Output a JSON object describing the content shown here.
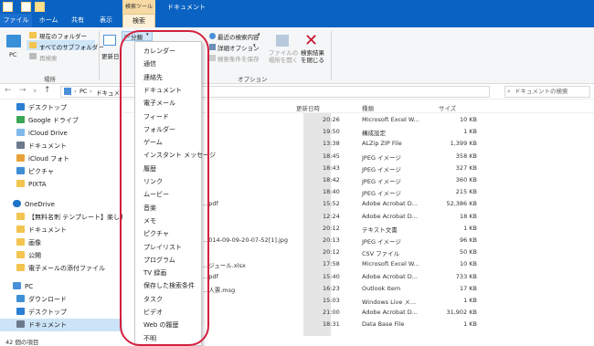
{
  "window": {
    "title": "ドキュメント",
    "context_header": "検索ツール"
  },
  "tabs": [
    "ファイル",
    "ホーム",
    "共有",
    "表示",
    "検索"
  ],
  "ribbon": {
    "pc_label": "PC",
    "current_folder": "現在のフォルダー",
    "all_subfolders": "すべてのサブフォルダー",
    "search_again": "再検索",
    "location_group": "場所",
    "updated_date": "更新日",
    "category_button": "分類",
    "recent_searches": "最近の検索内容",
    "advanced_options": "詳細オプション",
    "save_search": "検索条件を保存",
    "open_file_location": "ファイルの場所を開く",
    "close_search": "検索結果を閉じる",
    "options_group": "オプション"
  },
  "addressbar": {
    "path_root": "PC",
    "path_current": "ドキュメ",
    "search_placeholder": "ドキュメントの検索"
  },
  "dropdown_items": [
    "カレンダー",
    "通信",
    "連絡先",
    "ドキュメント",
    "電子メール",
    "フィード",
    "フォルダー",
    "ゲーム",
    "インスタント メッセージ",
    "履歴",
    "リンク",
    "ムービー",
    "音楽",
    "メモ",
    "ピクチャ",
    "プレイリスト",
    "プログラム",
    "TV 録画",
    "保存した検索条件",
    "タスク",
    "ビデオ",
    "Web の履歴",
    "不明"
  ],
  "nav": {
    "items": [
      {
        "label": "デスクトップ",
        "color": "#2a7fd4"
      },
      {
        "label": "Google ドライブ",
        "color": "#3aa757"
      },
      {
        "label": "iCloud Drive",
        "color": "#7fb8ea"
      },
      {
        "label": "ドキュメント",
        "color": "#6b7a8c"
      },
      {
        "label": "iCloud フォト",
        "color": "#e9a23b"
      },
      {
        "label": "ピクチャ",
        "color": "#3f8fd6"
      },
      {
        "label": "PIXTA",
        "color": "#f3c44f"
      },
      {
        "label": "OneDrive",
        "color": "#1e73c9"
      },
      {
        "label": "【無料名刺 テンプレート】楽しもう OF",
        "color": "#f3c44f"
      },
      {
        "label": "ドキュメント",
        "color": "#f3c44f"
      },
      {
        "label": "画像",
        "color": "#f3c44f"
      },
      {
        "label": "公開",
        "color": "#f3c44f"
      },
      {
        "label": "電子メールの添付ファイル",
        "color": "#f3c44f"
      },
      {
        "label": "PC",
        "color": "#4a90d9"
      },
      {
        "label": "ダウンロード",
        "color": "#3f8fd6"
      },
      {
        "label": "デスクトップ",
        "color": "#2a7fd4"
      },
      {
        "label": "ドキュメント",
        "color": "#6b7a8c"
      }
    ]
  },
  "columns": {
    "date": "更新日時",
    "type": "種類",
    "size": "サイズ"
  },
  "rows": [
    {
      "name": "",
      "time": "20:26",
      "type": "Microsoft Excel W...",
      "size": "10 KB"
    },
    {
      "name": "",
      "time": "19:50",
      "type": "構成設定",
      "size": "1 KB"
    },
    {
      "name": "",
      "time": "13:38",
      "type": "ALZip ZIP File",
      "size": "1,399 KB"
    },
    {
      "name": "",
      "time": "18:45",
      "type": "JPEG イメージ",
      "size": "358 KB"
    },
    {
      "name": "",
      "time": "18:43",
      "type": "JPEG イメージ",
      "size": "327 KB"
    },
    {
      "name": "",
      "time": "18:42",
      "type": "JPEG イメージ",
      "size": "360 KB"
    },
    {
      "name": "",
      "time": "18:40",
      "type": "JPEG イメージ",
      "size": "215 KB"
    },
    {
      "name": "...pdf",
      "time": "15:52",
      "type": "Adobe Acrobat D...",
      "size": "52,386 KB"
    },
    {
      "name": "",
      "time": "12:24",
      "type": "Adobe Acrobat D...",
      "size": "18 KB"
    },
    {
      "name": "",
      "time": "20:12",
      "type": "テキスト文書",
      "size": "1 KB"
    },
    {
      "name": "...014-09-09-20-07-52[1].jpg",
      "time": "20:13",
      "type": "JPEG イメージ",
      "size": "96 KB"
    },
    {
      "name": "",
      "time": "20:12",
      "type": "CSV ファイル",
      "size": "50 KB"
    },
    {
      "name": "...ジュール.xlsx",
      "time": "17:58",
      "type": "Microsoft Excel W...",
      "size": "10 KB"
    },
    {
      "name": "...pdf",
      "time": "15:40",
      "type": "Adobe Acrobat D...",
      "size": "733 KB"
    },
    {
      "name": "...人票.msg",
      "time": "16:23",
      "type": "Outlook Item",
      "size": "17 KB"
    },
    {
      "name": "",
      "time": "15:03",
      "type": "Windows Live メ...",
      "size": "1 KB"
    },
    {
      "name": "",
      "time": "21:00",
      "type": "Adobe Acrobat D...",
      "size": "31,902 KB"
    },
    {
      "name": "",
      "time": "18:31",
      "type": "Data Base File",
      "size": "1 KB"
    }
  ],
  "status": {
    "count": "42 個の項目"
  }
}
